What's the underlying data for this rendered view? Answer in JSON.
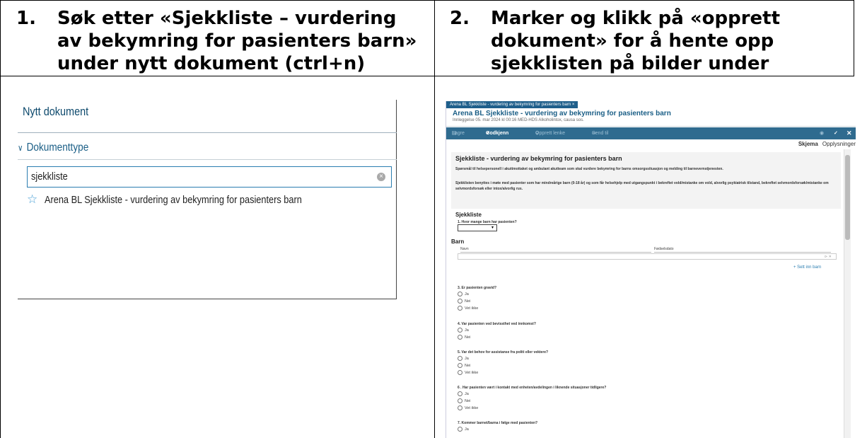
{
  "steps": [
    {
      "num": "1.",
      "text": "Søk etter «Sjekkliste – vurdering\nav bekymring for pasienters barn»\nunder nytt dokument (ctrl+n)"
    },
    {
      "num": "2.",
      "text": "Marker og klikk på «opprett\ndokument» for å hente opp\nsjekklisten på bilder under"
    }
  ],
  "new_document": {
    "title": "Nytt dokument",
    "section_label": "Dokumenttype",
    "section_icon": "chevron-down-icon",
    "search_value": "sjekkliste",
    "clear_icon": "clear-icon",
    "result_icon": "star-icon",
    "result_label": "Arena BL Sjekkliste - vurdering av bekymring for pasienters barn",
    "colors": {
      "title": "#0e4a6d",
      "input_border": "#2a7db0",
      "star": "#4aa0d6"
    }
  },
  "arena_form": {
    "tab_label": "Arena BL Sjekkliste - vurdering av bekymring for pasienters barn ×",
    "header_title": "Arena BL Sjekkliste - vurdering av bekymring for pasienters barn",
    "header_sub": "Innleggelse 05. mar 2024 kl 00:16 MED-HDS Alkoholintox, causa sos.",
    "toolbar": {
      "save": "Lagre",
      "approve": "Godkjenn",
      "create_link": "Opprett lenke",
      "send": "Send til",
      "icons": [
        "save-icon",
        "check-icon",
        "link-icon",
        "send-icon",
        "eye-icon",
        "collapse-icon",
        "close-icon"
      ]
    },
    "view_tabs": [
      "Skjema",
      "Opplysninger"
    ],
    "form_title": "Sjekkliste - vurdering av bekymring for pasienters barn",
    "intro_1": "Spørsmål til helsepersonell i akuttmottaket og ambulant akutteam som skal vurdere bekymring for barns omsorgssituasjon og melding til barnevernstjenesten.",
    "intro_2": "Sjekklisten benyttes i møte med pasienter som har mindreårige barn (0-18 år) og som får helsehjelp med utgangspunkt i bekreftet vold/mistanke om vold, alvorlig psykiatrisk tilstand, bekreftet selvmordsforsøk/mistanke om selvmordsforsøk eller intox/alvorlig rus.",
    "checklist_heading": "Sjekkliste",
    "q1": "1. Hvor mange barn har pasienten?",
    "q1_select": "▾",
    "children_heading": "Barn",
    "col_name": "Navn",
    "col_dob": "Fødselsdato",
    "row_action": "⊳ ✕",
    "add_child_link": "+ Sett inn barn",
    "q3": "3. Er pasienten gravid?",
    "q4": "4. Var pasienten ved bevissthet ved innkomst?",
    "q5": "5. Var det behov for assistanse fra politi eller vektere?",
    "q6": "6 . Har pasienten vært i kontakt med enheten/avdelingen i liknende situasjoner tidligere?",
    "q7": "7. Kommer barnet/barna i følge med pasienten?",
    "opt_yes": "Ja",
    "opt_no": "Nei",
    "opt_unknown": "Vet ikke"
  }
}
